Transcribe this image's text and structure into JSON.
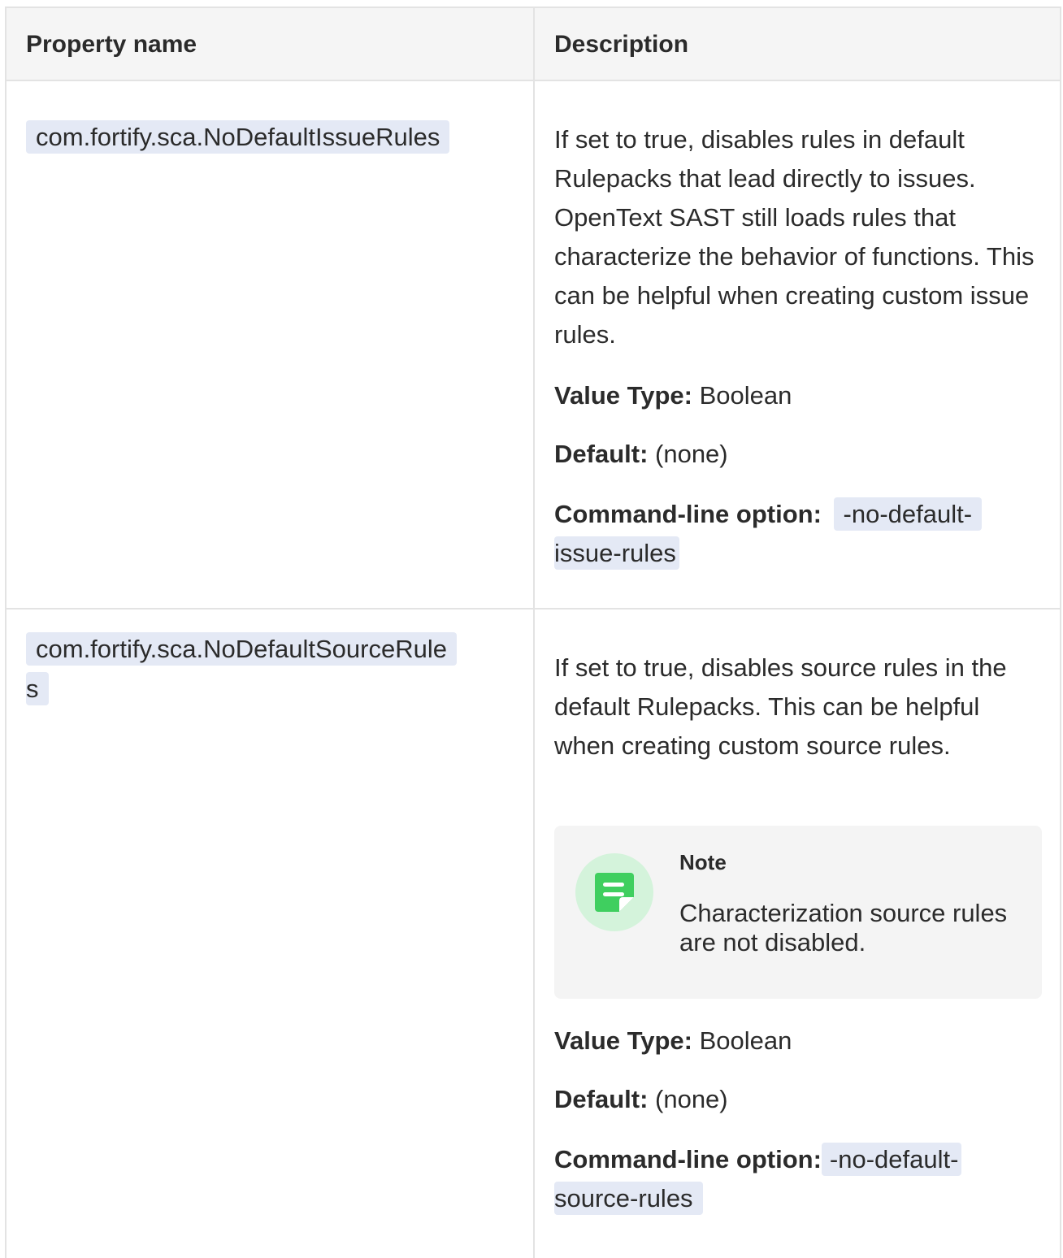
{
  "header": {
    "col1": "Property name",
    "col2": "Description"
  },
  "rows": [
    {
      "property": "com.fortify.sca.NoDefaultIssueRules",
      "description": "If set to true, disables rules in default Rulepacks that lead directly to issues. OpenText SAST still loads rules that characterize the behavior of functions. This can be helpful when creating custom issue rules.",
      "value_type_label": "Value Type:",
      "value_type": "Boolean",
      "default_label": "Default:",
      "default": "(none)",
      "option_label": "Command-line option:",
      "option_part1": "-no-default-",
      "option_part2": "issue-rules"
    },
    {
      "property_part1": "com.fortify.sca.NoDefaultSourceRule",
      "property_part2": "s",
      "description": "If set to true, disables source rules in the default Rulepacks. This can be helpful when creating custom source rules.",
      "note_title": "Note",
      "note_text": "Characterization source rules are not disabled.",
      "value_type_label": "Value Type:",
      "value_type": "Boolean",
      "default_label": "Default:",
      "default": "(none)",
      "option_label": "Command-line option:",
      "option_part1": "-no-default-",
      "option_part2": "source-rules"
    }
  ],
  "icons": {
    "note": "note-icon"
  },
  "colors": {
    "code_bg": "#e4e9f5",
    "header_bg": "#f5f5f5",
    "note_bg": "#f4f4f4",
    "note_icon_bg": "#d4f3db",
    "note_icon_fg": "#3fcf5f",
    "border": "#e3e3e3"
  }
}
